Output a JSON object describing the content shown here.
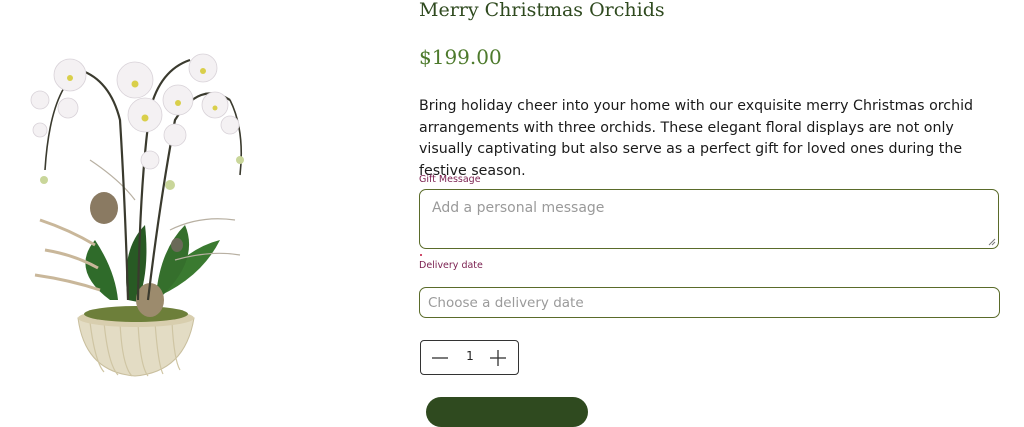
{
  "product": {
    "title": "Merry Christmas Orchids",
    "price": "$199.00",
    "description": "Bring holiday cheer into your home with our exquisite merry Christmas orchid arrangements with three orchids. These elegant floral displays are not only visually captivating but also serve as a perfect gift for loved ones during the festive season."
  },
  "form": {
    "gift_message": {
      "label": "Gift Message",
      "placeholder": "Add a personal message",
      "value": ""
    },
    "delivery_date": {
      "label": "Delivery date",
      "placeholder": "Choose a delivery date",
      "value": ""
    },
    "quantity": {
      "value": "1",
      "minus_icon": "minus-icon",
      "plus_icon": "plus-icon"
    }
  },
  "colors": {
    "title": "#2f4a1f",
    "price": "#4d7a2c",
    "label": "#7a1f4f",
    "field_border": "#5a6b2a",
    "button": "#2f4a1f"
  }
}
